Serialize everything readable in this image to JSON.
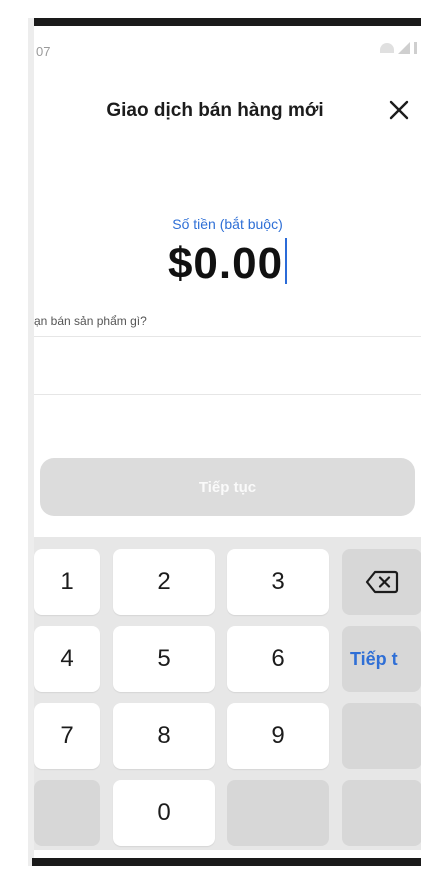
{
  "status_bar": {
    "time": "07"
  },
  "header": {
    "title": "Giao dịch bán hàng mới",
    "close_icon": "close-icon"
  },
  "amount": {
    "label": "Số tiền (bắt buộc)",
    "value": "$0.00"
  },
  "product": {
    "placeholder": "ạn bán sản phẩm gì?"
  },
  "continue_button": {
    "label": "Tiếp tục"
  },
  "keypad": {
    "keys": [
      "1",
      "2",
      "3",
      "4",
      "5",
      "6",
      "7",
      "8",
      "9",
      "0"
    ],
    "next_label": "Tiếp t",
    "backspace_icon": "backspace-icon"
  },
  "colors": {
    "accent": "#2e6fd6",
    "button_disabled": "#dcdcdc",
    "keypad_bg": "#e7e7e7"
  }
}
